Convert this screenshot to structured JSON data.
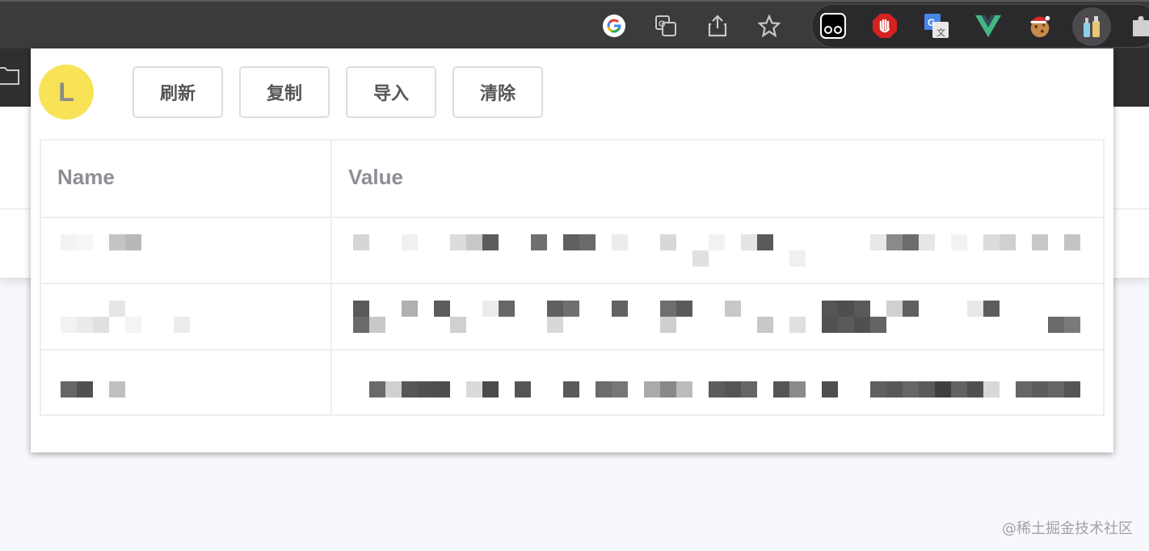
{
  "toolbar": {
    "icons": [
      "google-icon",
      "translate-icon",
      "share-icon",
      "star-icon"
    ]
  },
  "extensions": [
    "ghost-extension-icon",
    "adblock-icon",
    "google-translate-icon",
    "vue-devtools-icon",
    "cookie-editor-icon",
    "bottles-icon",
    "puzzle-icon"
  ],
  "popup": {
    "avatar_letter": "L",
    "buttons": {
      "refresh": "刷新",
      "copy": "复制",
      "import": "导入",
      "clear": "清除"
    },
    "table": {
      "headers": [
        "Name",
        "Value"
      ]
    }
  },
  "watermark": "@稀土掘金技术社区",
  "colors": {
    "avatar_bg": "#f8e256",
    "toolbar_bg": "#3b3b3d",
    "adblock_red": "#d6221f",
    "vue_green": "#41b883"
  }
}
